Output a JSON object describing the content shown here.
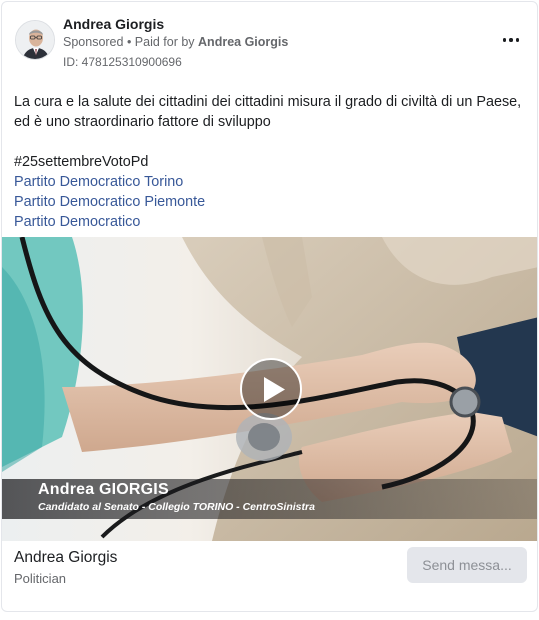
{
  "ad": {
    "page_name": "Andrea Giorgis",
    "sponsored": "Sponsored",
    "separator": " • ",
    "paid_for_prefix": "Paid for by ",
    "paid_for_by": "Andrea Giorgis",
    "library_id": "ID: 478125310900696",
    "body_text": "La cura e la salute dei cittadini dei cittadini misura il grado di civiltà di un Paese, ed è uno straordinario fattore di sviluppo",
    "hashtag": "#25settembreVotoPd",
    "links": [
      "Partito Democratico Torino",
      "Partito Democratico Piemonte",
      "Partito Democratico"
    ],
    "video": {
      "caption_name": "Andrea GIORGIS",
      "caption_role": "Candidato al Senato - Collegio TORINO - CentroSinistra"
    },
    "footer": {
      "page_name": "Andrea Giorgis",
      "category": "Politician",
      "cta": "Send messa..."
    }
  },
  "icons": {
    "more": "more-options-icon",
    "play": "play-icon"
  },
  "colors": {
    "link": "#385898",
    "muted": "#65676b",
    "button_bg": "#e4e6eb",
    "button_text": "#8d9096"
  }
}
